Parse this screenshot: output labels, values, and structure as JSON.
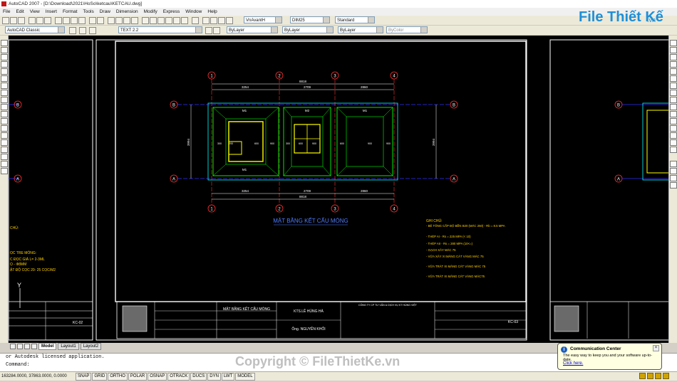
{
  "window": {
    "title": "AutoCAD 2007 - [D:\\Download\\2021\\HoSo\\ketcau\\KETCAU.dwg]"
  },
  "menu": [
    "File",
    "Edit",
    "View",
    "Insert",
    "Format",
    "Tools",
    "Draw",
    "Dimension",
    "Modify",
    "Express",
    "Window",
    "Help"
  ],
  "toolbar": {
    "text_font": "VnAvantH",
    "dim_style": "DIM25",
    "table_style": "Standard",
    "workspace": "AutoCAD Classic",
    "layer": "TEXT 2.2",
    "color": "ByLayer",
    "linetype": "ByLayer",
    "lineweight": "ByLayer",
    "plotstyle": "ByColor"
  },
  "logo": {
    "main": "File Thiết Kế",
    "suffix": ".vn"
  },
  "drawing": {
    "plan_title": "MẶT BẰNG KẾT CẤU MÓNG",
    "axes_top": [
      "1",
      "2",
      "3",
      "4"
    ],
    "axes_side": [
      "A",
      "B"
    ],
    "total_dim": "8818",
    "dims_top": [
      "3254",
      "2709",
      "2860"
    ],
    "dims_side": "3994",
    "dims_inner": [
      "300",
      "200",
      "600",
      "900",
      "300",
      "600",
      "900",
      "600",
      "900",
      "900"
    ],
    "footing_labels": [
      "M1",
      "M2",
      "M1",
      "M1"
    ],
    "notes_title": "GHI CHÚ:",
    "notes": [
      "- BÊ TÔNG CẤP ĐỘ BỀN B20 (MÁC 250) - Rb = 8.5 MPA",
      "- THÉP AI - Rs = 225 MPA (< 10)",
      "- THÉP AII - Rs = 280 MPA (10<=)",
      "- GẠCH XÂY MÁC 75",
      "- VỮA XÂY XI MĂNG CÁT VÀNG MÁC 75",
      "- VỮA TRÁT XI MĂNG CÁT VÀNG MÁC 75",
      "- VỮA TRÁT XI MĂNG CÁT VÀNG MÁC75"
    ],
    "left_notes_title": "CHÚ:",
    "left_notes": [
      "ỌC TRE MÓNG:",
      "C ĐỌC GIÁ L= 2-3ML",
      "Ọ - Ф8MM",
      "ẬT ĐỘ CỌC 20- 25 CỌC/M2"
    ],
    "sheet_left": "KC-02",
    "sheet_mid": "KC-03",
    "titleblock_title": "MẶT BẰNG KẾT CẤU MÓNG",
    "company": "CÔNG TY CP TƯ VẤN & DỊCH VỤ KT HÙNG VIỆT",
    "architect": "KTS.LÊ HÙNG HÀ",
    "owner": "Ông. NGUYỄN KHỐI",
    "ucs_label": "Y"
  },
  "tabs": [
    "Model",
    "Layout1",
    "Layout2"
  ],
  "command": {
    "line1": "or Autodesk licensed application.",
    "line2": "Command:"
  },
  "status": {
    "coords": "163284.0000, 37863.0000, 0.0000",
    "buttons": [
      "SNAP",
      "GRID",
      "ORTHO",
      "POLAR",
      "OSNAP",
      "OTRACK",
      "DUCS",
      "DYN",
      "LWT",
      "MODEL"
    ]
  },
  "watermark": "Copyright © FileThietKe.vn",
  "comm_center": {
    "title": "Communication Center",
    "body": "The easy way to keep you and your software up-to-date.",
    "link": "Click here."
  }
}
